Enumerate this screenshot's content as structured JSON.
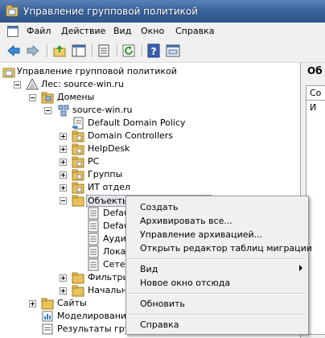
{
  "window": {
    "title": "Управление групповой политикой"
  },
  "menubar": {
    "items": [
      "Файл",
      "Действие",
      "Вид",
      "Окно",
      "Справка"
    ]
  },
  "toolbar": {
    "icons": [
      "back-arrow-icon",
      "forward-arrow-icon",
      "up-folder-icon",
      "show-tree-icon",
      "properties-icon",
      "refresh-icon",
      "help-icon",
      "console-icon"
    ]
  },
  "tree": {
    "root": "Управление групповой политикой",
    "forest": "Лес: source-win.ru",
    "domains": "Домены",
    "domain": "source-win.ru",
    "items": {
      "default_domain_policy": "Default Domain Policy",
      "domain_controllers": "Domain Controllers",
      "helpdesk": "HelpDesk",
      "pc": "PC",
      "groups": "Группы",
      "it_dept": "ИТ отдел",
      "objects": "Объекты",
      "obj_child_1": "Defau",
      "obj_child_2": "Defau",
      "obj_child_3": "Ауди",
      "obj_child_4": "Лока",
      "obj_child_5": "Сетев",
      "wmi_filters": "Фильтры",
      "starter": "Начальн"
    },
    "sites": "Сайты",
    "modeling": "Моделирование",
    "results": "Результаты груп"
  },
  "rightpane": {
    "title": "Об",
    "tab": "Со",
    "header": "И"
  },
  "context_menu": {
    "create": "Создать",
    "backup_all": "Архивировать все...",
    "manage_backups": "Управление архивацией...",
    "migration_editor": "Открыть редактор таблиц миграции",
    "view": "Вид",
    "new_window": "Новое окно отсюда",
    "refresh": "Обновить",
    "help": "Справка"
  },
  "colors": {
    "titlebar": "#3a629a",
    "menu_bg": "#f0f0f0",
    "selection": "#dfe3e8",
    "folder": "#e8c15a"
  }
}
